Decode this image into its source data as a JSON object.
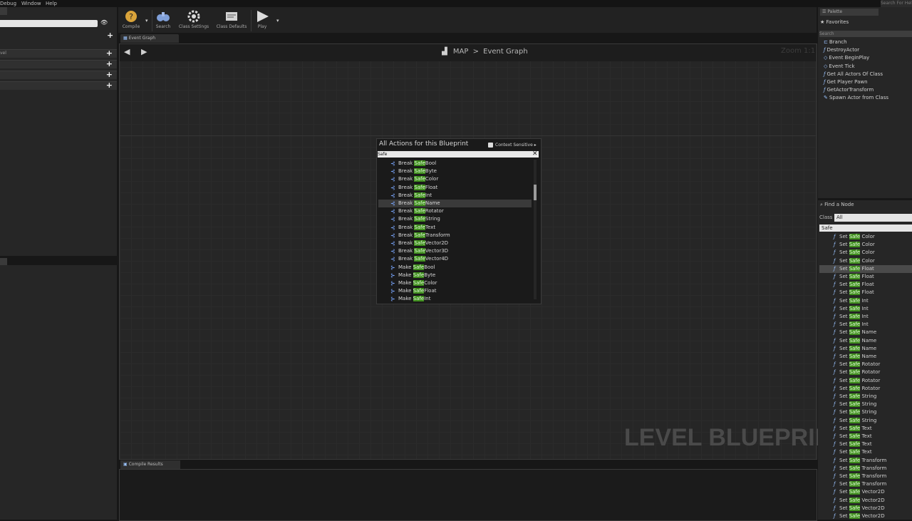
{
  "menubar": {
    "items": [
      "Debug",
      "Window",
      "Help"
    ],
    "search_help": "Search For Help"
  },
  "left_panel": {
    "row_label": "vel"
  },
  "toolbar": {
    "buttons": [
      {
        "label": "Compile",
        "icon": "compile-icon"
      },
      {
        "label": "Search",
        "icon": "binoculars-icon"
      },
      {
        "label": "Class Settings",
        "icon": "gear-icon"
      },
      {
        "label": "Class Defaults",
        "icon": "class-defaults-icon"
      },
      {
        "label": "Play",
        "icon": "play-icon"
      }
    ]
  },
  "graph": {
    "tab_label": "Event Graph",
    "breadcrumb": {
      "root": "MAP",
      "separator": ">",
      "current": "Event Graph"
    },
    "zoom": "Zoom 1:1",
    "watermark": "LEVEL BLUEPRINT"
  },
  "action_menu": {
    "title": "All Actions for this Blueprint",
    "context_label": "Context Sensitive",
    "search_value": "Safe",
    "items": [
      {
        "prefix": "Break ",
        "highlight": "Safe",
        "suffix": "Bool"
      },
      {
        "prefix": "Break ",
        "highlight": "Safe",
        "suffix": "Byte"
      },
      {
        "prefix": "Break ",
        "highlight": "Safe",
        "suffix": "Color"
      },
      {
        "prefix": "Break ",
        "highlight": "Safe",
        "suffix": "Float"
      },
      {
        "prefix": "Break ",
        "highlight": "Safe",
        "suffix": "Int"
      },
      {
        "prefix": "Break ",
        "highlight": "Safe",
        "suffix": "Name"
      },
      {
        "prefix": "Break ",
        "highlight": "Safe",
        "suffix": "Rotator"
      },
      {
        "prefix": "Break ",
        "highlight": "Safe",
        "suffix": "String"
      },
      {
        "prefix": "Break ",
        "highlight": "Safe",
        "suffix": "Text"
      },
      {
        "prefix": "Break ",
        "highlight": "Safe",
        "suffix": "Transform"
      },
      {
        "prefix": "Break ",
        "highlight": "Safe",
        "suffix": "Vector2D"
      },
      {
        "prefix": "Break ",
        "highlight": "Safe",
        "suffix": "Vector3D"
      },
      {
        "prefix": "Break ",
        "highlight": "Safe",
        "suffix": "Vector4D"
      },
      {
        "prefix": "Make ",
        "highlight": "Safe",
        "suffix": "Bool"
      },
      {
        "prefix": "Make ",
        "highlight": "Safe",
        "suffix": "Byte"
      },
      {
        "prefix": "Make ",
        "highlight": "Safe",
        "suffix": "Color"
      },
      {
        "prefix": "Make ",
        "highlight": "Safe",
        "suffix": "Float"
      },
      {
        "prefix": "Make ",
        "highlight": "Safe",
        "suffix": "Int"
      }
    ]
  },
  "compile_results": {
    "tab_label": "Compile Results"
  },
  "palette": {
    "tab_label": "Palette",
    "favorites_label": "Favorites",
    "search_placeholder": "Search",
    "items": [
      "Branch",
      "DestroyActor",
      "Event BeginPlay",
      "Event Tick",
      "Get All Actors Of Class",
      "Get Player Pawn",
      "GetActorTransform",
      "Spawn Actor from Class"
    ]
  },
  "find_node": {
    "title": "Find a Node",
    "class_label": "Class",
    "class_value": "All",
    "search_value": "Safe",
    "items": [
      {
        "prefix": "Set ",
        "highlight": "Safe",
        "suffix": " Color"
      },
      {
        "prefix": "Set ",
        "highlight": "Safe",
        "suffix": " Color"
      },
      {
        "prefix": "Set ",
        "highlight": "Safe",
        "suffix": " Color"
      },
      {
        "prefix": "Set ",
        "highlight": "Safe",
        "suffix": " Color"
      },
      {
        "prefix": "Set ",
        "highlight": "Safe",
        "suffix": " Float"
      },
      {
        "prefix": "Set ",
        "highlight": "Safe",
        "suffix": " Float"
      },
      {
        "prefix": "Set ",
        "highlight": "Safe",
        "suffix": " Float"
      },
      {
        "prefix": "Set ",
        "highlight": "Safe",
        "suffix": " Float"
      },
      {
        "prefix": "Set ",
        "highlight": "Safe",
        "suffix": " Int"
      },
      {
        "prefix": "Set ",
        "highlight": "Safe",
        "suffix": " Int"
      },
      {
        "prefix": "Set ",
        "highlight": "Safe",
        "suffix": " Int"
      },
      {
        "prefix": "Set ",
        "highlight": "Safe",
        "suffix": " Int"
      },
      {
        "prefix": "Set ",
        "highlight": "Safe",
        "suffix": " Name"
      },
      {
        "prefix": "Set ",
        "highlight": "Safe",
        "suffix": " Name"
      },
      {
        "prefix": "Set ",
        "highlight": "Safe",
        "suffix": " Name"
      },
      {
        "prefix": "Set ",
        "highlight": "Safe",
        "suffix": " Name"
      },
      {
        "prefix": "Set ",
        "highlight": "Safe",
        "suffix": " Rotator"
      },
      {
        "prefix": "Set ",
        "highlight": "Safe",
        "suffix": " Rotator"
      },
      {
        "prefix": "Set ",
        "highlight": "Safe",
        "suffix": " Rotator"
      },
      {
        "prefix": "Set ",
        "highlight": "Safe",
        "suffix": " Rotator"
      },
      {
        "prefix": "Set ",
        "highlight": "Safe",
        "suffix": " String"
      },
      {
        "prefix": "Set ",
        "highlight": "Safe",
        "suffix": " String"
      },
      {
        "prefix": "Set ",
        "highlight": "Safe",
        "suffix": " String"
      },
      {
        "prefix": "Set ",
        "highlight": "Safe",
        "suffix": " String"
      },
      {
        "prefix": "Set ",
        "highlight": "Safe",
        "suffix": " Text"
      },
      {
        "prefix": "Set ",
        "highlight": "Safe",
        "suffix": " Text"
      },
      {
        "prefix": "Set ",
        "highlight": "Safe",
        "suffix": " Text"
      },
      {
        "prefix": "Set ",
        "highlight": "Safe",
        "suffix": " Text"
      },
      {
        "prefix": "Set ",
        "highlight": "Safe",
        "suffix": " Transform"
      },
      {
        "prefix": "Set ",
        "highlight": "Safe",
        "suffix": " Transform"
      },
      {
        "prefix": "Set ",
        "highlight": "Safe",
        "suffix": " Transform"
      },
      {
        "prefix": "Set ",
        "highlight": "Safe",
        "suffix": " Transform"
      },
      {
        "prefix": "Set ",
        "highlight": "Safe",
        "suffix": " Vector2D"
      },
      {
        "prefix": "Set ",
        "highlight": "Safe",
        "suffix": " Vector2D"
      },
      {
        "prefix": "Set ",
        "highlight": "Safe",
        "suffix": " Vector2D"
      },
      {
        "prefix": "Set ",
        "highlight": "Safe",
        "suffix": " Vector2D"
      }
    ]
  },
  "colors": {
    "highlight": "#3e8d1c",
    "function_icon": "#9ac3ff",
    "background": "#171717"
  }
}
